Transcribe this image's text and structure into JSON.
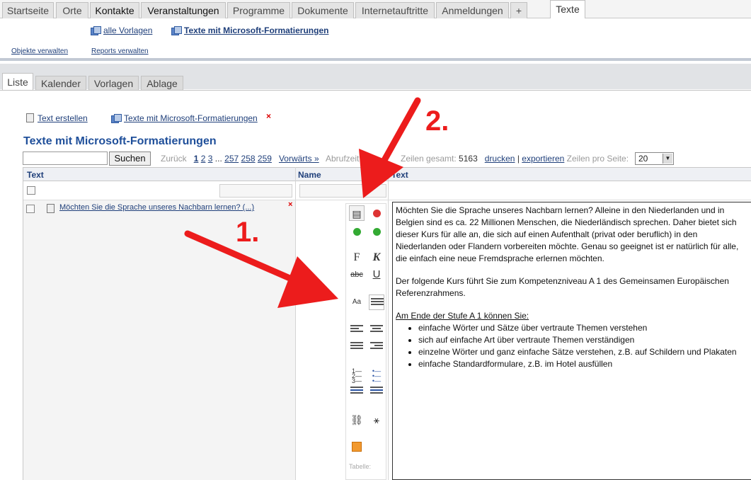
{
  "top_nav": {
    "tabs": [
      "Startseite",
      "Orte",
      "Kontakte",
      "Veranstaltungen",
      "Programme",
      "Dokumente",
      "Internetauftritte",
      "Anmeldungen",
      "+"
    ],
    "active_tab": "Texte"
  },
  "sub_nav": {
    "all_templates": "alle Vorlagen",
    "current_template": "Texte mit Microsoft-Formatierungen",
    "manage_objects": "Objekte verwalten",
    "manage_reports": "Reports verwalten"
  },
  "view_tabs": [
    "Liste",
    "Kalender",
    "Vorlagen",
    "Ablage"
  ],
  "actions": {
    "create_text": "Text erstellen",
    "template_link": "Texte mit Microsoft-Formatierungen",
    "remove": "×"
  },
  "page_title": "Texte mit Microsoft-Formatierungen",
  "search": {
    "button": "Suchen",
    "value": ""
  },
  "pager": {
    "back": "Zurück",
    "pages": [
      "1",
      "2",
      "3",
      "...",
      "257",
      "258",
      "259"
    ],
    "forward": "Vorwärts »",
    "fetch_time_label": "Abrufzeit: 0.",
    "rows_total_label": "Zeilen gesamt:",
    "rows_total": "5163",
    "print": "drucken",
    "separator": "|",
    "export": "exportieren",
    "rows_per_page_label": "Zeilen pro Seite:",
    "rows_per_page": "20"
  },
  "table": {
    "headers": [
      "Text",
      "Name",
      "Text"
    ],
    "row_title": "Möchten Sie die Sprache unseres Nachbarn lernen? (...)",
    "row_delete": "×"
  },
  "toolbar": {
    "bold": "F",
    "italic": "K",
    "strike": "abc",
    "underline": "U",
    "table_label": "Tabelle:"
  },
  "text_content": {
    "p1": "Möchten Sie die Sprache unseres Nachbarn lernen? Alleine in den Niederlanden und in Belgien sind es ca. 22 Millionen Menschen, die Niederländisch sprechen. Daher bietet sich dieser Kurs für alle an, die sich auf einen Aufenthalt (privat oder beruflich) in den Niederlanden oder Flandern vorbereiten möchte. Genau so geeignet ist er natürlich für alle, die einfach eine neue Fremdsprache erlernen möchten.",
    "p2": "Der folgende Kurs führt Sie zum Kompetenzniveau A 1 des Gemeinsamen Europäischen Referenzrahmens.",
    "list_heading": "Am Ende der Stufe A 1 können Sie:",
    "list": [
      "einfache Wörter und Sätze über vertraute Themen verstehen",
      "sich auf einfache Art über vertraute Themen verständigen",
      "einzelne Wörter und ganz einfache Sätze verstehen, z.B. auf Schildern und Plakaten",
      "einfache Standardformulare, z.B. im Hotel ausfüllen"
    ]
  },
  "annotations": {
    "label1": "1.",
    "label2": "2.",
    "color": "#ec1c1c"
  }
}
